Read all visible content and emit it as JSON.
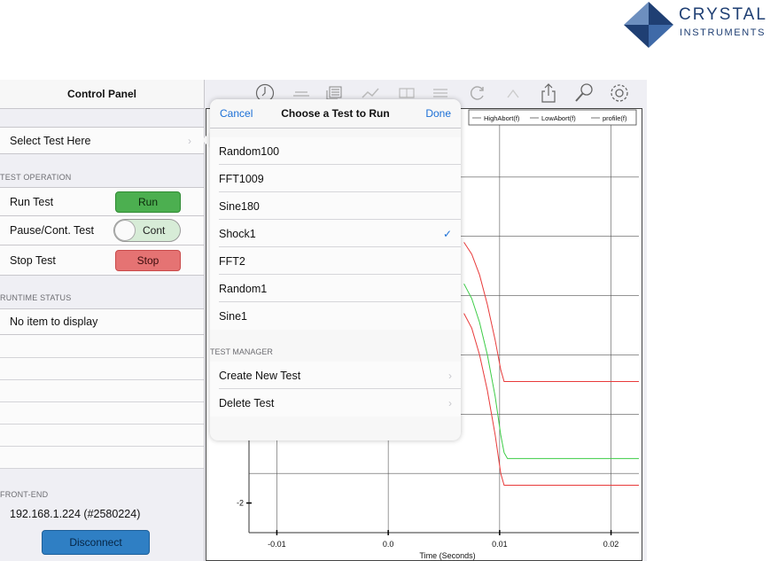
{
  "logo": {
    "line1": "CRYSTAL",
    "line2": "INSTRUMENTS",
    "colors": {
      "dark": "#1f3f73",
      "light": "#6d8fbf"
    }
  },
  "panel": {
    "title": "Control Panel",
    "select_test": "Select Test Here",
    "sections": {
      "test_operation": "TEST OPERATION",
      "runtime_status": "RUNTIME STATUS",
      "front_end": "FRONT-END"
    },
    "run_row": {
      "label": "Run Test",
      "button": "Run"
    },
    "pause_row": {
      "label": "Pause/Cont. Test",
      "button": "Cont"
    },
    "stop_row": {
      "label": "Stop Test",
      "button": "Stop"
    },
    "runtime_empty": "No item to display",
    "ip_address": "192.168.1.224 (#2580224)",
    "disconnect": "Disconnect"
  },
  "toolbar": {
    "icons": [
      "clock-icon",
      "signal-icon",
      "layers-icon",
      "chart-icon",
      "grid-icon",
      "list-icon",
      "refresh-icon",
      "cursor-icon",
      "share-icon",
      "search-icon",
      "gear-icon"
    ]
  },
  "popover": {
    "cancel": "Cancel",
    "title": "Choose a Test to Run",
    "done": "Done",
    "tests": [
      {
        "name": "Random100",
        "selected": false
      },
      {
        "name": "FFT1009",
        "selected": false
      },
      {
        "name": "Sine180",
        "selected": false
      },
      {
        "name": "Shock1",
        "selected": true
      },
      {
        "name": "FFT2",
        "selected": false
      },
      {
        "name": "Random1",
        "selected": false
      },
      {
        "name": "Sine1",
        "selected": false
      }
    ],
    "check_mark": "✓",
    "manager_section": "TEST MANAGER",
    "manager_items": [
      "Create New Test",
      "Delete Test"
    ]
  },
  "chart_data": {
    "type": "line",
    "xlabel": "Time (Seconds)",
    "ylabel": "",
    "xlim": [
      -0.0125,
      0.0225
    ],
    "ylim": [
      -2.5,
      4.5
    ],
    "x_ticks": [
      -0.01,
      0.0,
      0.01,
      0.02
    ],
    "x_tick_labels": [
      "-0.01",
      "0.0",
      "0.01",
      "0.02"
    ],
    "y_ticks": [
      -2
    ],
    "y_tick_labels": [
      "-2"
    ],
    "legend": [
      "HighAbort(f)",
      "LowAbort(f)",
      "profile(f)"
    ],
    "legend_position": "top-right",
    "series": [
      {
        "name": "HighAbort(f)",
        "color": "#e83a3a",
        "x": [
          0.0068,
          0.0075,
          0.0082,
          0.0089,
          0.0096,
          0.0101,
          0.0104,
          0.0225
        ],
        "y": [
          2.4,
          2.2,
          1.85,
          1.35,
          0.75,
          0.25,
          0.05,
          0.05
        ]
      },
      {
        "name": "profile(f)",
        "color": "#3ccc46",
        "x": [
          0.0068,
          0.0075,
          0.0082,
          0.0089,
          0.0096,
          0.0101,
          0.0104,
          0.0107,
          0.0225
        ],
        "y": [
          1.7,
          1.45,
          1.05,
          0.5,
          -0.2,
          -0.85,
          -1.15,
          -1.25,
          -1.25
        ]
      },
      {
        "name": "LowAbort(f)",
        "color": "#e83a3a",
        "x": [
          0.0068,
          0.0075,
          0.0082,
          0.0089,
          0.0096,
          0.0101,
          0.0104,
          0.0225
        ],
        "y": [
          1.2,
          0.95,
          0.5,
          -0.1,
          -0.85,
          -1.5,
          -1.7,
          -1.7
        ]
      }
    ],
    "grid": true
  }
}
